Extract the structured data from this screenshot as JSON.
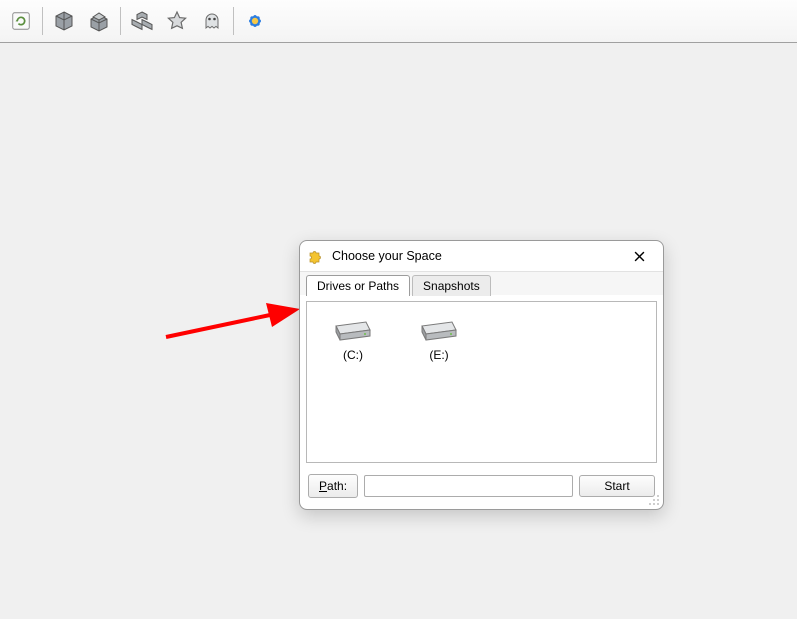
{
  "toolbar": {
    "refresh_tip": "Refresh",
    "box_tip": "Scan",
    "box_open_tip": "Open",
    "modules_tip": "Components",
    "star_tip": "Favorites",
    "ghost_tip": "Ghost",
    "gear_tip": "Settings"
  },
  "dialog": {
    "title": "Choose your Space",
    "tabs": {
      "drives": "Drives or Paths",
      "snapshots": "Snapshots"
    },
    "drives": [
      {
        "label": "(C:)"
      },
      {
        "label": "(E:)"
      }
    ],
    "path_label_u": "P",
    "path_label_rest": "ath:",
    "path_value": "",
    "path_placeholder": "",
    "start_label": "Start"
  }
}
